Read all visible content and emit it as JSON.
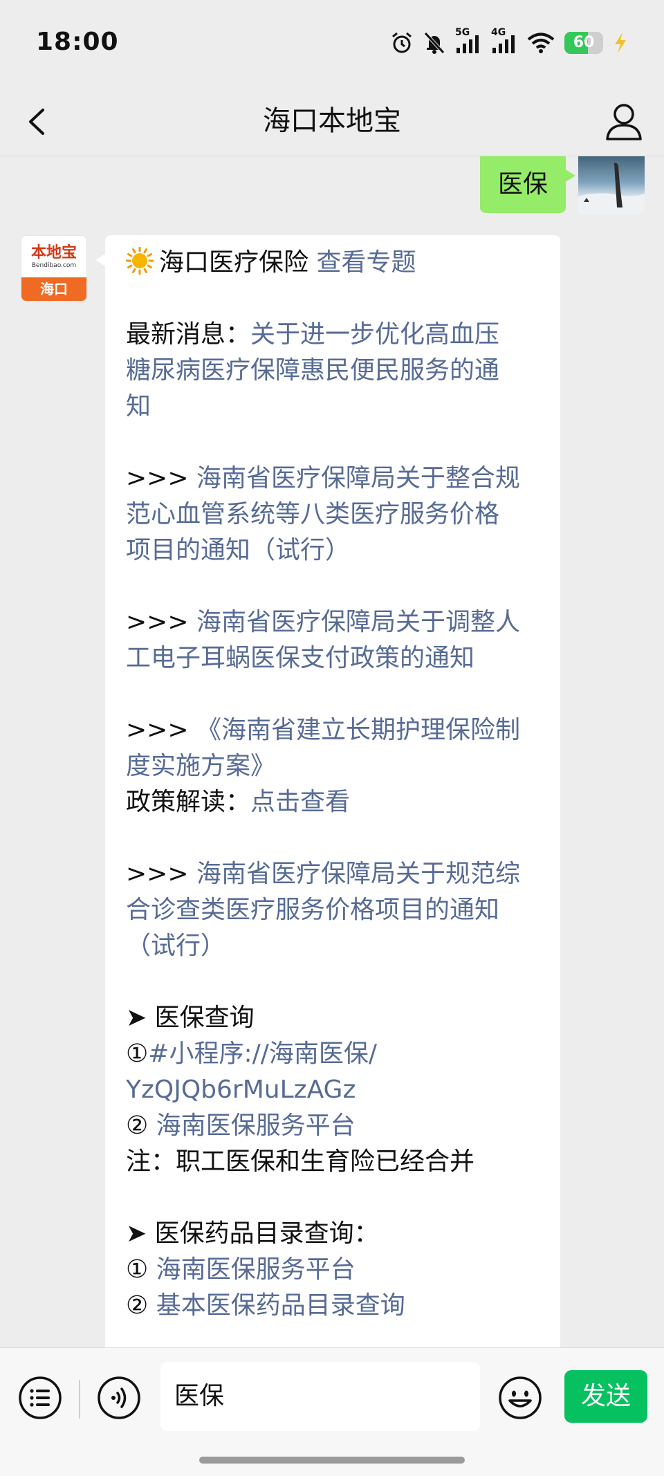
{
  "status": {
    "time": "18:00",
    "network1": "5G",
    "network2": "4G",
    "battery": "60",
    "icons": [
      "alarm-icon",
      "mute-bell-icon",
      "signal-icon",
      "signal-icon",
      "wifi-icon",
      "battery-icon",
      "charging-icon"
    ]
  },
  "nav": {
    "title": "海口本地宝"
  },
  "chat": {
    "outgoing": {
      "text": "医保"
    },
    "bot": {
      "avatar_top": "本地宝",
      "avatar_domain": "Bendibao.com",
      "avatar_city": "海口",
      "lines": [
        {
          "parts": [
            {
              "t": "海口医疗保险 ",
              "link": false
            },
            {
              "t": "查看专题",
              "link": true
            }
          ],
          "sun": true
        },
        {
          "blank": true
        },
        {
          "parts": [
            {
              "t": "最新消息：",
              "link": false
            },
            {
              "t": "关于进一步优化高血压",
              "link": true
            }
          ]
        },
        {
          "parts": [
            {
              "t": "糖尿病医疗保障惠民便民服务的通",
              "link": true
            }
          ]
        },
        {
          "parts": [
            {
              "t": "知",
              "link": true
            }
          ]
        },
        {
          "blank": true
        },
        {
          "parts": [
            {
              "t": ">>> ",
              "link": false
            },
            {
              "t": "海南省医疗保障局关于整合规",
              "link": true
            }
          ]
        },
        {
          "parts": [
            {
              "t": "范心血管系统等八类医疗服务价格",
              "link": true
            }
          ]
        },
        {
          "parts": [
            {
              "t": "项目的通知（试行）",
              "link": true
            }
          ]
        },
        {
          "blank": true
        },
        {
          "parts": [
            {
              "t": ">>> ",
              "link": false
            },
            {
              "t": "海南省医疗保障局关于调整人",
              "link": true
            }
          ]
        },
        {
          "parts": [
            {
              "t": "工电子耳蜗医保支付政策的通知",
              "link": true
            }
          ]
        },
        {
          "blank": true
        },
        {
          "parts": [
            {
              "t": ">>> ",
              "link": false
            },
            {
              "t": "《海南省建立长期护理保险制",
              "link": true
            }
          ]
        },
        {
          "parts": [
            {
              "t": "度实施方案》",
              "link": true
            }
          ]
        },
        {
          "parts": [
            {
              "t": "政策解读：",
              "link": false
            },
            {
              "t": "点击查看",
              "link": true
            }
          ]
        },
        {
          "blank": true
        },
        {
          "parts": [
            {
              "t": ">>> ",
              "link": false
            },
            {
              "t": "海南省医疗保障局关于规范综",
              "link": true
            }
          ]
        },
        {
          "parts": [
            {
              "t": "合诊查类医疗服务价格项目的通知",
              "link": true
            }
          ]
        },
        {
          "parts": [
            {
              "t": "（试行）",
              "link": true
            }
          ]
        },
        {
          "blank": true
        },
        {
          "parts": [
            {
              "t": "➤ 医保查询",
              "link": false
            }
          ]
        },
        {
          "parts": [
            {
              "t": "①",
              "link": false
            },
            {
              "t": "#小程序://海南医保/",
              "link": true
            }
          ]
        },
        {
          "parts": [
            {
              "t": "YzQJQb6rMuLzAGz",
              "link": true
            }
          ]
        },
        {
          "parts": [
            {
              "t": "② ",
              "link": false
            },
            {
              "t": "海南医保服务平台",
              "link": true
            }
          ]
        },
        {
          "parts": [
            {
              "t": "注：职工医保和生育险已经合并",
              "link": false
            }
          ]
        },
        {
          "blank": true
        },
        {
          "parts": [
            {
              "t": "➤ 医保药品目录查询：",
              "link": false
            }
          ]
        },
        {
          "parts": [
            {
              "t": "① ",
              "link": false
            },
            {
              "t": "海南医保服务平台",
              "link": true
            }
          ]
        },
        {
          "parts": [
            {
              "t": "② ",
              "link": false
            },
            {
              "t": "基本医保药品目录查询",
              "link": true
            }
          ]
        }
      ]
    }
  },
  "input": {
    "value": "医保",
    "send_label": "发送"
  },
  "colors": {
    "link": "#576b95",
    "bubble_out": "#95ec69",
    "send": "#07c160"
  }
}
